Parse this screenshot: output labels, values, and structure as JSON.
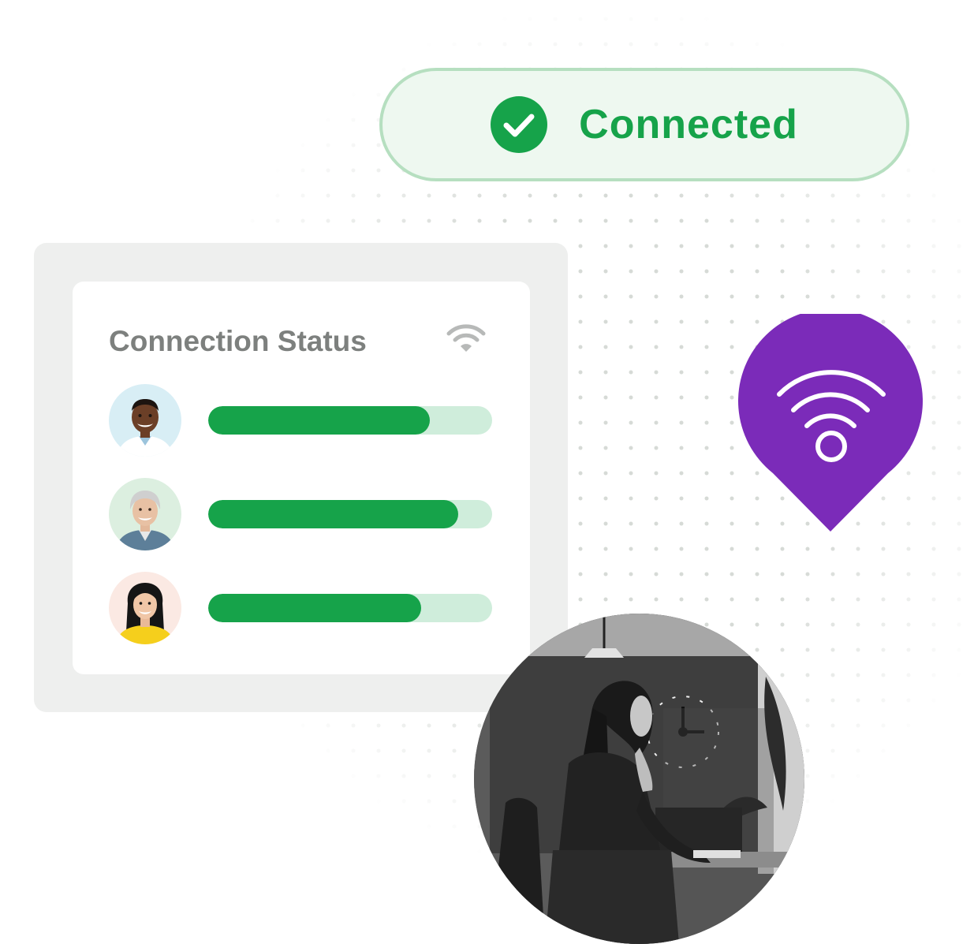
{
  "status_pill": {
    "label": "Connected",
    "icon": "check-circle-icon",
    "accent": "#16a34a"
  },
  "connection_card": {
    "title": "Connection Status",
    "icon": "wifi-icon",
    "users": [
      {
        "avatar": "avatar-man-smiling",
        "progress": 0.78
      },
      {
        "avatar": "avatar-woman-gray-hair",
        "progress": 0.88
      },
      {
        "avatar": "avatar-woman-yellow-top",
        "progress": 0.75
      }
    ]
  },
  "location_pin": {
    "icon": "wifi-location-pin-icon",
    "color": "#7b2bb9"
  },
  "photo": {
    "subject": "woman-at-desk-photo"
  },
  "colors": {
    "bar_fill": "#16a34a",
    "bar_track": "#cfeddb",
    "pill_background": "#eef8f0",
    "pill_border": "#b6dfc0"
  }
}
